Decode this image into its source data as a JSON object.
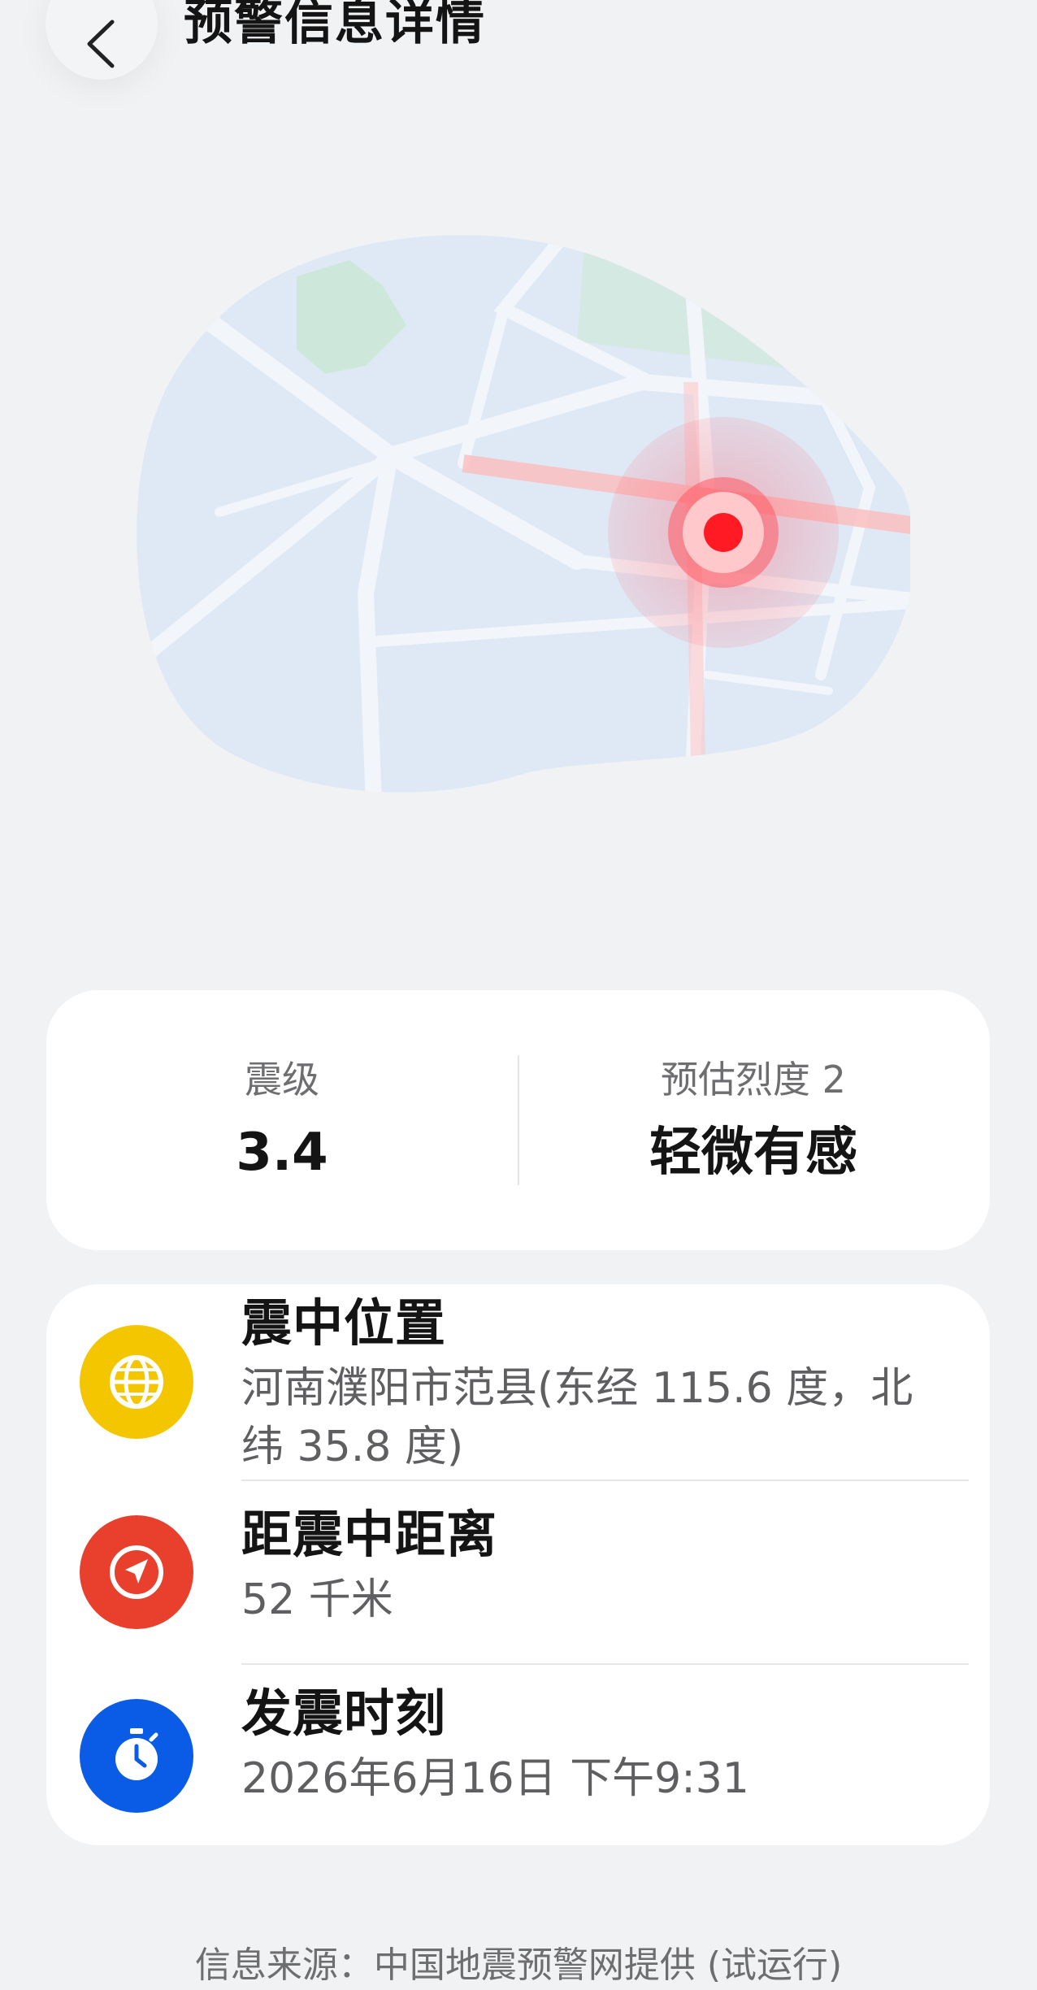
{
  "header": {
    "title": "预警信息详情",
    "back_icon": "chevron-left-icon"
  },
  "map": {
    "epicenter_color": "#ff1a24"
  },
  "magnitude_card": {
    "magnitude_label": "震级",
    "magnitude_value": "3.4",
    "intensity_label": "预估烈度 2",
    "intensity_value": "轻微有感"
  },
  "info": {
    "epicenter": {
      "title": "震中位置",
      "line1": "河南濮阳市范县(东经 115.6 度，北",
      "line2": "纬 35.8 度)",
      "icon": "globe-icon",
      "icon_color": "#f3c600"
    },
    "distance": {
      "title": "距震中距离",
      "value": "52 千米",
      "icon": "navigation-arrow-icon",
      "icon_color": "#e8402c"
    },
    "time": {
      "title": "发震时刻",
      "value": "2026年6月16日 下午9:31",
      "icon": "stopwatch-icon",
      "icon_color": "#0a5ce6"
    }
  },
  "footer": {
    "source": "信息来源：中国地震预警网提供 (试运行)"
  }
}
